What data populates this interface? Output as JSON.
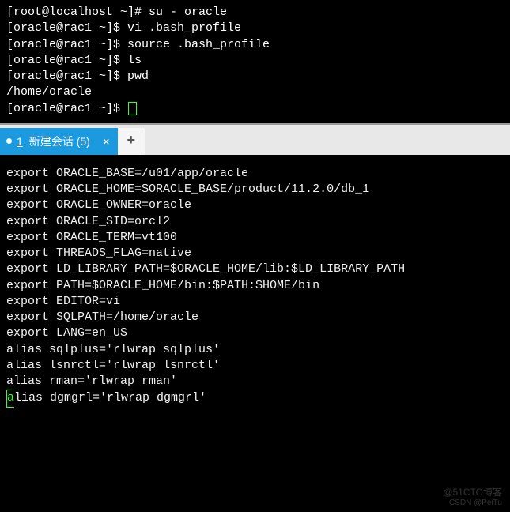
{
  "top_terminal": {
    "lines": [
      {
        "prompt": "[root@localhost ~]# ",
        "cmd": "su - oracle"
      },
      {
        "prompt": "[oracle@rac1 ~]$ ",
        "cmd": "vi .bash_profile"
      },
      {
        "prompt": "[oracle@rac1 ~]$ ",
        "cmd": "source .bash_profile"
      },
      {
        "prompt": "[oracle@rac1 ~]$ ",
        "cmd": "ls"
      },
      {
        "prompt": "[oracle@rac1 ~]$ ",
        "cmd": "pwd"
      },
      {
        "prompt": "",
        "cmd": "/home/oracle"
      },
      {
        "prompt": "[oracle@rac1 ~]$ ",
        "cmd": "",
        "cursor": true
      }
    ]
  },
  "tabs": {
    "active": {
      "index": "1",
      "label": "新建会话 (5)"
    },
    "close_glyph": "×",
    "add_glyph": "+"
  },
  "bottom_terminal": {
    "lines": [
      "export ORACLE_BASE=/u01/app/oracle",
      "export ORACLE_HOME=$ORACLE_BASE/product/11.2.0/db_1",
      "export ORACLE_OWNER=oracle",
      "export ORACLE_SID=orcl2",
      "export ORACLE_TERM=vt100",
      "export THREADS_FLAG=native",
      "export LD_LIBRARY_PATH=$ORACLE_HOME/lib:$LD_LIBRARY_PATH",
      "export PATH=$ORACLE_HOME/bin:$PATH:$HOME/bin",
      "export EDITOR=vi",
      "export SQLPATH=/home/oracle",
      "export LANG=en_US",
      "alias sqlplus='rlwrap sqlplus'",
      "alias lsnrctl='rlwrap lsnrctl'",
      "alias rman='rlwrap rman'",
      "alias dgmgrl='rlwrap dgmgrl'"
    ],
    "cursor_on_last": true
  },
  "watermark": {
    "main": "@51CTO博客",
    "sub": "CSDN @PeiTu"
  }
}
